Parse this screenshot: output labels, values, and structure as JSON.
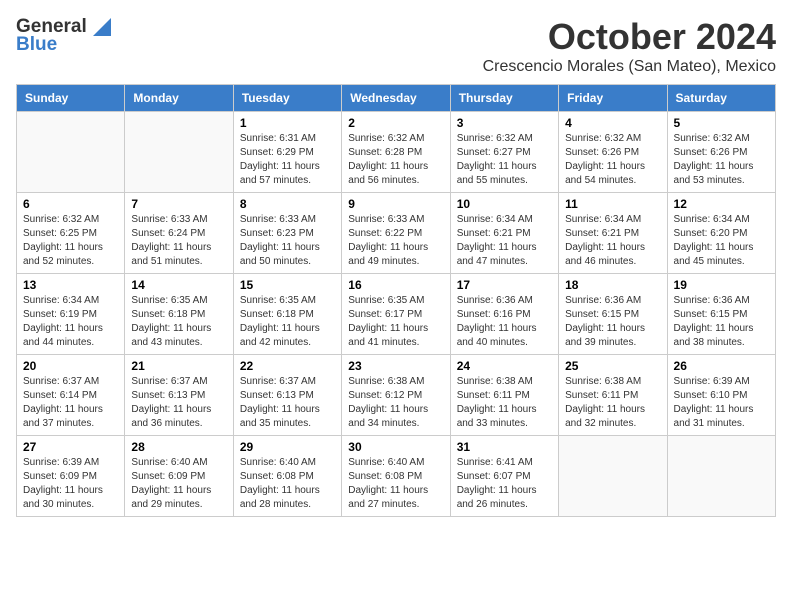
{
  "logo": {
    "general": "General",
    "blue": "Blue"
  },
  "title": "October 2024",
  "subtitle": "Crescencio Morales (San Mateo), Mexico",
  "days_of_week": [
    "Sunday",
    "Monday",
    "Tuesday",
    "Wednesday",
    "Thursday",
    "Friday",
    "Saturday"
  ],
  "weeks": [
    [
      {
        "day": "",
        "info": ""
      },
      {
        "day": "",
        "info": ""
      },
      {
        "day": "1",
        "info": "Sunrise: 6:31 AM\nSunset: 6:29 PM\nDaylight: 11 hours and 57 minutes."
      },
      {
        "day": "2",
        "info": "Sunrise: 6:32 AM\nSunset: 6:28 PM\nDaylight: 11 hours and 56 minutes."
      },
      {
        "day": "3",
        "info": "Sunrise: 6:32 AM\nSunset: 6:27 PM\nDaylight: 11 hours and 55 minutes."
      },
      {
        "day": "4",
        "info": "Sunrise: 6:32 AM\nSunset: 6:26 PM\nDaylight: 11 hours and 54 minutes."
      },
      {
        "day": "5",
        "info": "Sunrise: 6:32 AM\nSunset: 6:26 PM\nDaylight: 11 hours and 53 minutes."
      }
    ],
    [
      {
        "day": "6",
        "info": "Sunrise: 6:32 AM\nSunset: 6:25 PM\nDaylight: 11 hours and 52 minutes."
      },
      {
        "day": "7",
        "info": "Sunrise: 6:33 AM\nSunset: 6:24 PM\nDaylight: 11 hours and 51 minutes."
      },
      {
        "day": "8",
        "info": "Sunrise: 6:33 AM\nSunset: 6:23 PM\nDaylight: 11 hours and 50 minutes."
      },
      {
        "day": "9",
        "info": "Sunrise: 6:33 AM\nSunset: 6:22 PM\nDaylight: 11 hours and 49 minutes."
      },
      {
        "day": "10",
        "info": "Sunrise: 6:34 AM\nSunset: 6:21 PM\nDaylight: 11 hours and 47 minutes."
      },
      {
        "day": "11",
        "info": "Sunrise: 6:34 AM\nSunset: 6:21 PM\nDaylight: 11 hours and 46 minutes."
      },
      {
        "day": "12",
        "info": "Sunrise: 6:34 AM\nSunset: 6:20 PM\nDaylight: 11 hours and 45 minutes."
      }
    ],
    [
      {
        "day": "13",
        "info": "Sunrise: 6:34 AM\nSunset: 6:19 PM\nDaylight: 11 hours and 44 minutes."
      },
      {
        "day": "14",
        "info": "Sunrise: 6:35 AM\nSunset: 6:18 PM\nDaylight: 11 hours and 43 minutes."
      },
      {
        "day": "15",
        "info": "Sunrise: 6:35 AM\nSunset: 6:18 PM\nDaylight: 11 hours and 42 minutes."
      },
      {
        "day": "16",
        "info": "Sunrise: 6:35 AM\nSunset: 6:17 PM\nDaylight: 11 hours and 41 minutes."
      },
      {
        "day": "17",
        "info": "Sunrise: 6:36 AM\nSunset: 6:16 PM\nDaylight: 11 hours and 40 minutes."
      },
      {
        "day": "18",
        "info": "Sunrise: 6:36 AM\nSunset: 6:15 PM\nDaylight: 11 hours and 39 minutes."
      },
      {
        "day": "19",
        "info": "Sunrise: 6:36 AM\nSunset: 6:15 PM\nDaylight: 11 hours and 38 minutes."
      }
    ],
    [
      {
        "day": "20",
        "info": "Sunrise: 6:37 AM\nSunset: 6:14 PM\nDaylight: 11 hours and 37 minutes."
      },
      {
        "day": "21",
        "info": "Sunrise: 6:37 AM\nSunset: 6:13 PM\nDaylight: 11 hours and 36 minutes."
      },
      {
        "day": "22",
        "info": "Sunrise: 6:37 AM\nSunset: 6:13 PM\nDaylight: 11 hours and 35 minutes."
      },
      {
        "day": "23",
        "info": "Sunrise: 6:38 AM\nSunset: 6:12 PM\nDaylight: 11 hours and 34 minutes."
      },
      {
        "day": "24",
        "info": "Sunrise: 6:38 AM\nSunset: 6:11 PM\nDaylight: 11 hours and 33 minutes."
      },
      {
        "day": "25",
        "info": "Sunrise: 6:38 AM\nSunset: 6:11 PM\nDaylight: 11 hours and 32 minutes."
      },
      {
        "day": "26",
        "info": "Sunrise: 6:39 AM\nSunset: 6:10 PM\nDaylight: 11 hours and 31 minutes."
      }
    ],
    [
      {
        "day": "27",
        "info": "Sunrise: 6:39 AM\nSunset: 6:09 PM\nDaylight: 11 hours and 30 minutes."
      },
      {
        "day": "28",
        "info": "Sunrise: 6:40 AM\nSunset: 6:09 PM\nDaylight: 11 hours and 29 minutes."
      },
      {
        "day": "29",
        "info": "Sunrise: 6:40 AM\nSunset: 6:08 PM\nDaylight: 11 hours and 28 minutes."
      },
      {
        "day": "30",
        "info": "Sunrise: 6:40 AM\nSunset: 6:08 PM\nDaylight: 11 hours and 27 minutes."
      },
      {
        "day": "31",
        "info": "Sunrise: 6:41 AM\nSunset: 6:07 PM\nDaylight: 11 hours and 26 minutes."
      },
      {
        "day": "",
        "info": ""
      },
      {
        "day": "",
        "info": ""
      }
    ]
  ]
}
